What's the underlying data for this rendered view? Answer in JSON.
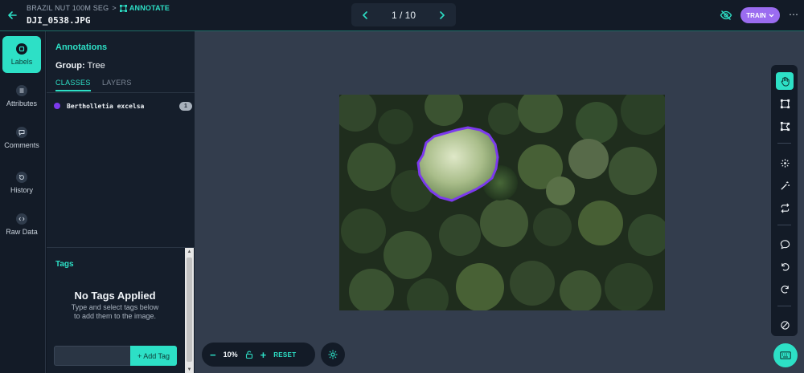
{
  "header": {
    "breadcrumb_project": "BRAZIL NUT 100M SEG",
    "breadcrumb_separator": ">",
    "breadcrumb_current": "ANNOTATE",
    "filename": "DJI_0538.JPG",
    "pager_text": "1 / 10",
    "train_label": "TRAIN",
    "more_label": "⋯"
  },
  "nav": {
    "items": [
      {
        "label": "Labels",
        "icon": "labels-icon"
      },
      {
        "label": "Attributes",
        "icon": "attributes-icon"
      },
      {
        "label": "Comments",
        "icon": "comments-icon"
      },
      {
        "label": "History",
        "icon": "history-icon"
      },
      {
        "label": "Raw Data",
        "icon": "raw-data-icon"
      }
    ]
  },
  "panel": {
    "title": "Annotations",
    "group_label": "Group:",
    "group_value": "Tree",
    "tabs": [
      "CLASSES",
      "LAYERS"
    ],
    "classes": [
      {
        "name": "Bertholletia excelsa",
        "count": "1",
        "color": "#7c3aed"
      }
    ]
  },
  "tags": {
    "title": "Tags",
    "empty_title": "No Tags Applied",
    "empty_hint_1": "Type and select tags below",
    "empty_hint_2": "to add them to the image.",
    "input_value": "",
    "add_label": "+ Add Tag"
  },
  "zoom": {
    "minus": "−",
    "level": "10%",
    "plus": "+",
    "reset": "RESET"
  },
  "colors": {
    "accent": "#2de0c6",
    "train": "#9b6cf0",
    "annotation_outline": "#7c3aed"
  }
}
